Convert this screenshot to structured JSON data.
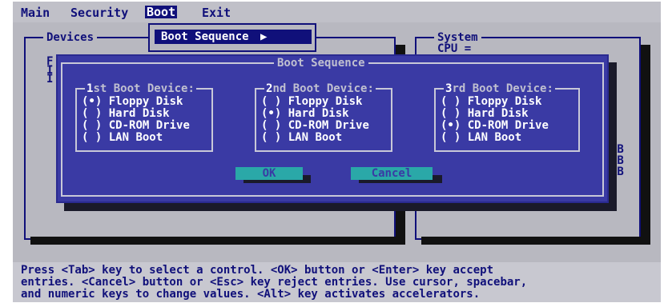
{
  "menu": {
    "items": [
      {
        "label": "Main"
      },
      {
        "label": "Security"
      },
      {
        "label": "Boot"
      },
      {
        "label": "Exit"
      }
    ],
    "active_index": 2
  },
  "panels": {
    "devices_title": "Devices",
    "system_title": "System",
    "cpu_label": "CPU =",
    "left_letters": [
      "F",
      "I",
      "I"
    ],
    "right_units": [
      "KB",
      "KB",
      "KB"
    ]
  },
  "boot_sequence_button": {
    "label": "Boot Sequence",
    "arrow": "▶"
  },
  "dialog": {
    "title": "Boot Sequence",
    "groups": [
      {
        "title_first_char": "1",
        "title_rest": "st Boot Device:",
        "options": [
          {
            "mark": "(•)",
            "label": "Floppy Disk",
            "selected": true
          },
          {
            "mark": "( )",
            "label": "Hard Disk",
            "selected": false
          },
          {
            "mark": "( )",
            "label": "CD-ROM Drive",
            "selected": false
          },
          {
            "mark": "( )",
            "label": "LAN Boot",
            "selected": false
          }
        ]
      },
      {
        "title_first_char": "2",
        "title_rest": "nd Boot Device:",
        "options": [
          {
            "mark": "( )",
            "label": "Floppy Disk",
            "selected": false
          },
          {
            "mark": "(•)",
            "label": "Hard Disk",
            "selected": true
          },
          {
            "mark": "( )",
            "label": "CD-ROM Drive",
            "selected": false
          },
          {
            "mark": "( )",
            "label": "LAN Boot",
            "selected": false
          }
        ]
      },
      {
        "title_first_char": "3",
        "title_rest": "rd Boot Device:",
        "options": [
          {
            "mark": "( )",
            "label": "Floppy Disk",
            "selected": false
          },
          {
            "mark": "( )",
            "label": "Hard Disk",
            "selected": false
          },
          {
            "mark": "(•)",
            "label": "CD-ROM Drive",
            "selected": true
          },
          {
            "mark": "( )",
            "label": "LAN Boot",
            "selected": false
          }
        ]
      }
    ],
    "ok_label": "OK",
    "cancel_label": "Cancel"
  },
  "status": {
    "lines": [
      "Press <Tab> key to select a control. <OK> button or <Enter> key accept",
      "entries. <Cancel> button or <Esc> key reject entries. Use cursor, spacebar,",
      "and numeric keys to change values. <Alt> key activates accelerators."
    ]
  },
  "colors": {
    "bios_grey": "#b8b8c0",
    "bios_blue": "#10107a",
    "dialog_blue": "#3a3aa4",
    "button_cyan": "#2aa8a8"
  }
}
